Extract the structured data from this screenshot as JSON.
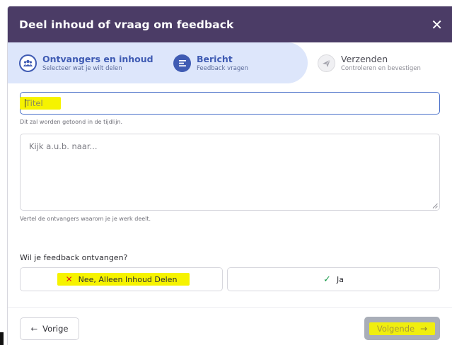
{
  "dialog": {
    "title": "Deel inhoud of vraag om feedback",
    "close_symbol": "✕"
  },
  "steps": [
    {
      "label": "Ontvangers en inhoud",
      "sublabel": "Selecteer wat je wilt delen",
      "icon": "people-icon",
      "state": "completed"
    },
    {
      "label": "Bericht",
      "sublabel": "Feedback vragen",
      "icon": "message-icon",
      "state": "active"
    },
    {
      "label": "Verzenden",
      "sublabel": "Controleren en bevestigen",
      "icon": "send-icon",
      "state": "upcoming"
    }
  ],
  "form": {
    "title_input": {
      "value": "",
      "placeholder": "Titel",
      "help": "Dit zal worden getoond in de tijdlijn."
    },
    "message": {
      "value": "",
      "placeholder": "Kijk a.u.b. naar...",
      "help": "Vertel de ontvangers waarom je je werk deelt."
    },
    "feedback_question": "Wil je feedback ontvangen?",
    "options": {
      "no": {
        "label": "Nee, Alleen Inhoud Delen",
        "icon": "x-icon"
      },
      "yes": {
        "label": "Ja",
        "icon": "check-icon"
      }
    }
  },
  "footer": {
    "prev_label": "Vorige",
    "prev_arrow": "←",
    "next_label": "Volgende",
    "next_arrow": "→"
  },
  "colors": {
    "header_bg": "#4b3c66",
    "accent": "#3f5bb3",
    "active_step_bg": "#dde6fb",
    "highlight": "#f6f300",
    "no_icon": "#d9261c",
    "yes_icon": "#1e9d4e",
    "next_disabled_bg": "#a9aeb8"
  }
}
